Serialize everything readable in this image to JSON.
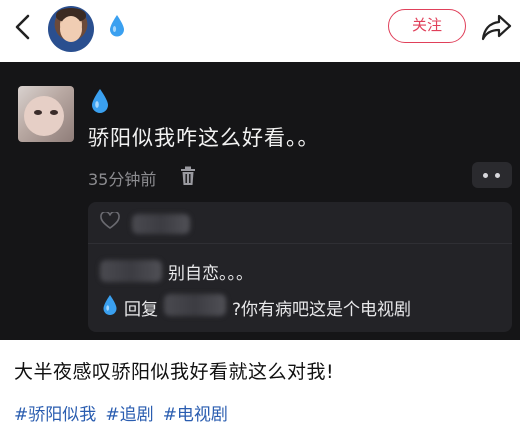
{
  "header": {
    "follow_label": "关注"
  },
  "comment": {
    "text": "骄阳似我咋这么好看。。",
    "time": "35分钟前"
  },
  "reply_box": {
    "reply1_text": "别自恋。。。",
    "reply2_prefix": "回复",
    "reply2_text": "?你有病吧这是个电视剧"
  },
  "caption": "大半夜感叹骄阳似我好看就这么对我!",
  "tags": [
    "#骄阳似我",
    "#追剧",
    "#电视剧"
  ],
  "colors": {
    "accent": "#e0405a",
    "drop": "#3aa0f0",
    "tag": "#2a5db0",
    "panel": "#151517"
  }
}
